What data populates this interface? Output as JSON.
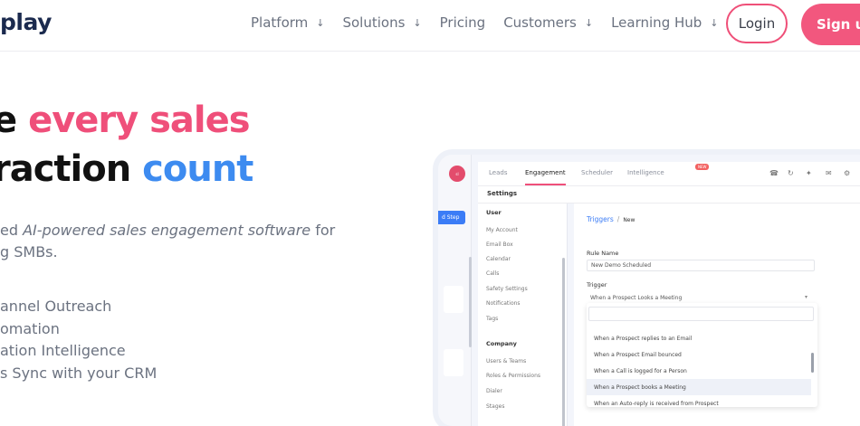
{
  "nav": {
    "logo": "play",
    "menu": [
      {
        "label": "Platform",
        "has_arrow": true
      },
      {
        "label": "Solutions",
        "has_arrow": true
      },
      {
        "label": "Pricing",
        "has_arrow": false
      },
      {
        "label": "Customers",
        "has_arrow": true
      },
      {
        "label": "Learning Hub",
        "has_arrow": true
      }
    ],
    "arrow_glyph": "↓",
    "login_label": "Login",
    "signup_label": "Sign up"
  },
  "hero": {
    "line1_a": "e ",
    "line1_b": "every sales",
    "line2_a": "raction ",
    "line2_b": "count",
    "desc_a": "ed ",
    "desc_em": "AI-powered sales engagement software",
    "desc_b": " for",
    "desc_line2": "g SMBs.",
    "features": [
      "annel Outreach",
      "omation",
      "ation Intelligence",
      "s Sync with your CRM"
    ]
  },
  "app": {
    "rail": {
      "logo_text": "sl",
      "add_step": "d Step"
    },
    "tabs": [
      "Leads",
      "Engagement",
      "Scheduler",
      "Intelligence"
    ],
    "new_badge": "NEW",
    "settings_title": "Settings",
    "side_sections": {
      "user": "User",
      "company": "Company"
    },
    "side_user_items": [
      "My Account",
      "Email Box",
      "Calendar",
      "Calls",
      "Safety Settings",
      "Notifications",
      "Tags"
    ],
    "side_company_items": [
      "Users & Teams",
      "Roles & Permissions",
      "Dialer",
      "Stages"
    ],
    "breadcrumb": {
      "link": "Triggers",
      "separator": "/",
      "current": "New"
    },
    "rule_name_label": "Rule Name",
    "rule_name_value": "New Demo Scheduled",
    "trigger_label": "Trigger",
    "trigger_value": "When a Prospect Looks a Meeting",
    "options": [
      "When a Prospect replies to an Email",
      "When a Prospect Email bounced",
      "When a Call is logged for a Person",
      "When a Prospect books a Meeting",
      "When an Auto-reply is received from Prospect"
    ],
    "highlighted_option_index": 3,
    "colors": {
      "accent_pink": "#ef4f7a",
      "accent_blue": "#3b7cf6"
    }
  }
}
